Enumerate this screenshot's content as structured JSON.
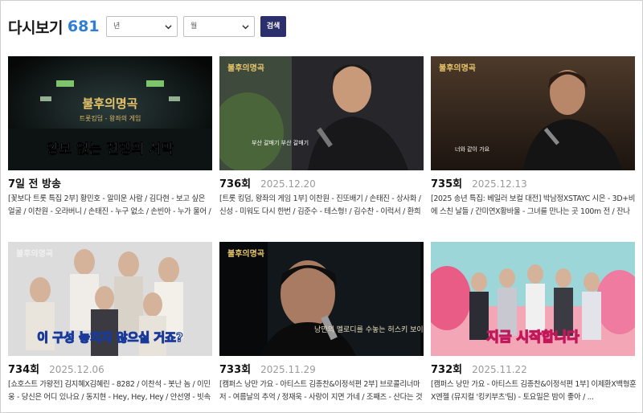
{
  "header": {
    "title": "다시보기",
    "count": "681"
  },
  "filters": {
    "year_placeholder": "년",
    "month_placeholder": "월",
    "search_label": "검색"
  },
  "episodes": [
    {
      "episode": "7일 전 방송",
      "date": "",
      "description": "[꽃보다 트롯 특집 2부] 황민호 - 알미운 사람 / 김다현 - 보고 싶은 얼굴 / 이찬원 - 오라버니 / 손태진 - 누구 없소 / 손빈아 - 누가 울어 / 춘길 -...",
      "caption": "양보 없는 전쟁의 서막",
      "logo": "불후의명곡",
      "subtitle": "트롯킹덤 - 왕좌의 게임"
    },
    {
      "episode": "736회",
      "date": "2025.12.20",
      "description": "[트롯 킹덤, 왕좌의 게임 1부] 이찬원 - 진또배기 / 손태진 - 상사화 / 신성 - 미워도 다시 한번 / 김준수 - 테스형! / 김수찬 - 이럭서 / 환희 - 님과 함...",
      "caption": "부산 갈매기 부산 갈매기",
      "logo": "불후의명곡",
      "subtitle": ""
    },
    {
      "episode": "735회",
      "date": "2025.12.13",
      "description": "[2025 송년 특집: 베일러 보컬 대전] 박남정XSTAYC 시은 - 3D+비에 스친 날들 / 간미연X황바울 - 그녀를 만나는 곳 100m 전 / 잔나비X최정훈 -...",
      "caption": "너와 같이 가요",
      "logo": "불후의명곡",
      "subtitle": ""
    },
    {
      "episode": "734회",
      "date": "2025.12.06",
      "description": "[쇼호스트 가왕전] 김지혜X김혜린 - 8282 / 이찬석 - 봇난 놈 / 이민웅 - 당신은 어디 있나요 / 동지현 - Hey, Hey, Hey / 안선영 - 빗속의 여인...",
      "caption": "이 구성 놓치지 않으실 거죠?",
      "logo": "불후의명곡",
      "subtitle": ""
    },
    {
      "episode": "733회",
      "date": "2025.11.29",
      "description": "[캠퍼스 낭만 가요 - 아티스트 김종찬&이정석편 2부] 브로콜리너마저 - 여름날의 추억 / 정재욱 - 사랑이 지면 가네 / 조째즈 - 산다는 것은 / ...",
      "caption": "낭만의 멜로디를 수놓는 허스키 보이스",
      "logo": "불후의명곡",
      "subtitle": ""
    },
    {
      "episode": "732회",
      "date": "2025.11.22",
      "description": "[캠퍼스 낭만 가요 - 아티스트 김종찬&이정석편 1부] 이제환X백형훈X엔젤 (뮤지컬 '킹키부츠'팀) - 토요일은 밤이 좋아 / ...",
      "caption": "지금 시작합니다",
      "logo": "불후의명곡",
      "subtitle": ""
    }
  ]
}
